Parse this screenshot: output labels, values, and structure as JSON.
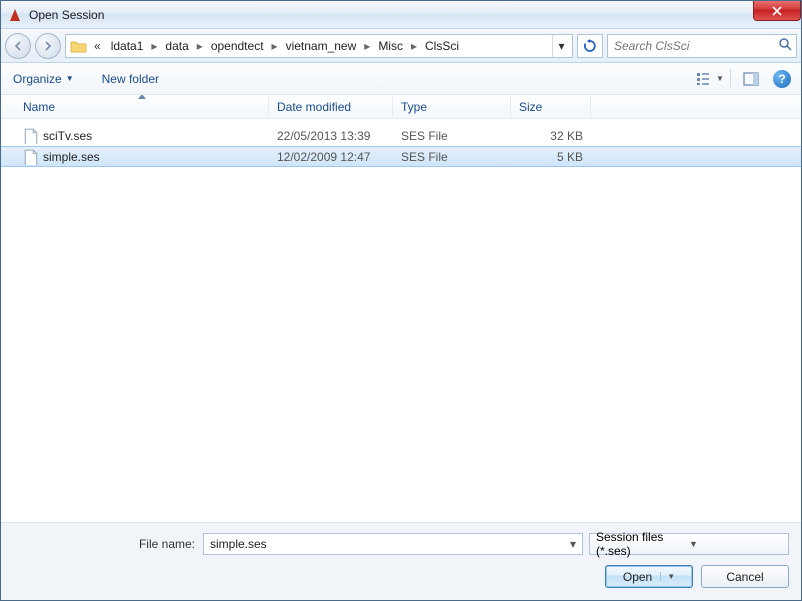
{
  "window": {
    "title": "Open Session"
  },
  "breadcrumb": {
    "prefix": "«",
    "items": [
      "ldata1",
      "data",
      "opendtect",
      "vietnam_new",
      "Misc",
      "ClsSci"
    ]
  },
  "search": {
    "placeholder": "Search ClsSci"
  },
  "toolbar": {
    "organize": "Organize",
    "new_folder": "New folder"
  },
  "columns": {
    "name": "Name",
    "date": "Date modified",
    "type": "Type",
    "size": "Size"
  },
  "files": [
    {
      "name": "sciTv.ses",
      "date": "22/05/2013 13:39",
      "type": "SES File",
      "size": "32 KB",
      "selected": false
    },
    {
      "name": "simple.ses",
      "date": "12/02/2009 12:47",
      "type": "SES File",
      "size": "5 KB",
      "selected": true
    }
  ],
  "filename": {
    "label": "File name:",
    "value": "simple.ses"
  },
  "filter": {
    "label": "Session files (*.ses)"
  },
  "buttons": {
    "open": "Open",
    "cancel": "Cancel"
  }
}
